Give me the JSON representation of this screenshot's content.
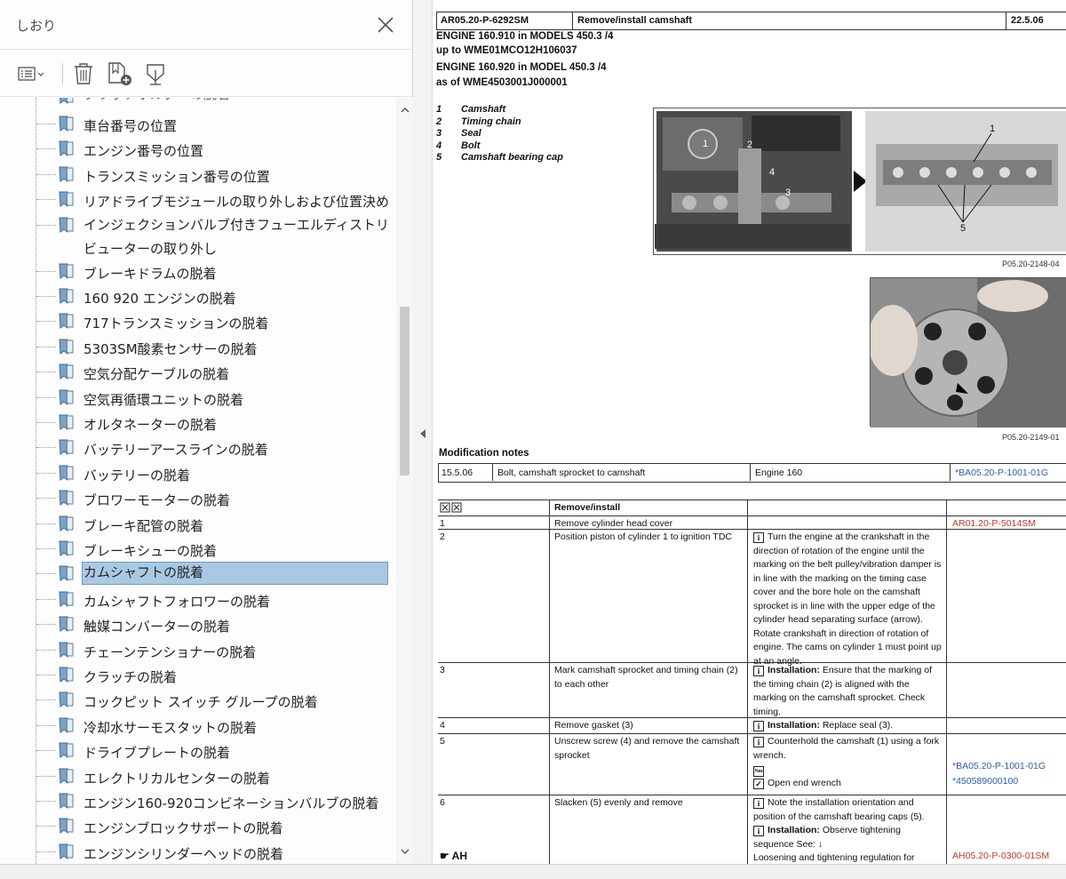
{
  "panel": {
    "title": "しおり",
    "bookmarks": [
      {
        "label": "クラッチホルダーの脱着"
      },
      {
        "label": "車台番号の位置"
      },
      {
        "label": "エンジン番号の位置"
      },
      {
        "label": "トランスミッション番号の位置"
      },
      {
        "label": "リアドライブモジュールの取り外しおよび位置決め"
      },
      {
        "label": "インジェクションバルブ付きフューエルディストリビューターの取り外し"
      },
      {
        "label": "ブレーキドラムの脱着"
      },
      {
        "label": "160 920 エンジンの脱着"
      },
      {
        "label": "717トランスミッションの脱着"
      },
      {
        "label": "5303SM酸素センサーの脱着"
      },
      {
        "label": "空気分配ケーブルの脱着"
      },
      {
        "label": "空気再循環ユニットの脱着"
      },
      {
        "label": "オルタネーターの脱着"
      },
      {
        "label": "バッテリーアースラインの脱着"
      },
      {
        "label": "バッテリーの脱着"
      },
      {
        "label": "ブロワーモーターの脱着"
      },
      {
        "label": "ブレーキ配管の脱着"
      },
      {
        "label": "ブレーキシューの脱着"
      },
      {
        "label": "カムシャフトの脱着"
      },
      {
        "label": "カムシャフトフォロワーの脱着"
      },
      {
        "label": "触媒コンバーターの脱着"
      },
      {
        "label": "チェーンテンショナーの脱着"
      },
      {
        "label": "クラッチの脱着"
      },
      {
        "label": "コックピット スイッチ グループの脱着"
      },
      {
        "label": "冷却水サーモスタットの脱着"
      },
      {
        "label": "ドライブプレートの脱着"
      },
      {
        "label": "エレクトリカルセンターの脱着"
      },
      {
        "label": "エンジン160-920コンビネーションバルブの脱着"
      },
      {
        "label": "エンジンブロックサポートの脱着"
      },
      {
        "label": "エンジンシリンダーヘッドの脱着"
      }
    ],
    "selected_index": 18
  },
  "doc": {
    "header": {
      "code": "AR05.20-P-6292SM",
      "title": "Remove/install camshaft",
      "date": "22.5.06"
    },
    "engine1": "ENGINE    160.910 in MODELS 450.3 /4",
    "engine1b": "up to WME01MCO12H106037",
    "engine2": "ENGINE    160.920 in MODEL 450.3 /4",
    "engine2b": "as of WME4503001J000001",
    "legend": [
      {
        "num": "1",
        "text": "Camshaft"
      },
      {
        "num": "2",
        "text": "Timing chain"
      },
      {
        "num": "3",
        "text": "Seal"
      },
      {
        "num": "4",
        "text": "Bolt"
      },
      {
        "num": "5",
        "text": "Camshaft bearing cap"
      }
    ],
    "photo1_ref": "P05.20-2148-04",
    "photo2_ref": "P05.20-2149-01",
    "mod_title": "Modification notes",
    "mod": {
      "date": "15.5.06",
      "text": "Bolt, camshaft sprocket to camshaft",
      "engine": "Engine 160",
      "link": "*BA05.20-P-1001-01G"
    },
    "steps_header": "Remove/install",
    "steps": [
      {
        "n": "1",
        "action": "Remove cylinder head cover",
        "note": "",
        "ref": "AR01.20-P-5014SM"
      },
      {
        "n": "2",
        "action": "Position piston of cylinder 1 to ignition TDC",
        "note": "Turn the engine at the crankshaft in the direction of rotation of the engine until the marking on the belt pulley/vibration damper is in line with the marking on the timing case cover and the bore hole on the camshaft sprocket is in line with the upper edge of the cylinder head separating surface (arrow). Rotate crankshaft in direction of rotation of engine. The cams on cylinder 1 must point up at an angle.",
        "ref": ""
      },
      {
        "n": "3",
        "action": "Mark camshaft sprocket and timing chain (2) to each other",
        "note_bold": "Installation:",
        "note": "Ensure that the marking of the timing chain (2) is aligned with the marking on the camshaft sprocket. Check timing.",
        "ref": ""
      },
      {
        "n": "4",
        "action": "Remove gasket (3)",
        "note_bold": "Installation:",
        "note": "Replace seal (3).",
        "ref": ""
      },
      {
        "n": "5",
        "action": "Unscrew screw (4) and remove the camshaft sprocket",
        "note": "Counterhold the camshaft (1) using a fork wrench.",
        "note_extra": "Open end wrench",
        "ref": "*BA05.20-P-1001-01G",
        "ref2": "*450589000100"
      },
      {
        "n": "6",
        "action": "Slacken (5) evenly and remove",
        "note": "Note the installation orientation and position of the camshaft bearing caps (5).",
        "note_bold2": "Installation:",
        "note2": "Observe tightening sequence See: ↓",
        "note3": "Loosening and tightening regulation for",
        "ref": "AH05.20-P-0300-01SM",
        "ah": "AH"
      }
    ]
  }
}
